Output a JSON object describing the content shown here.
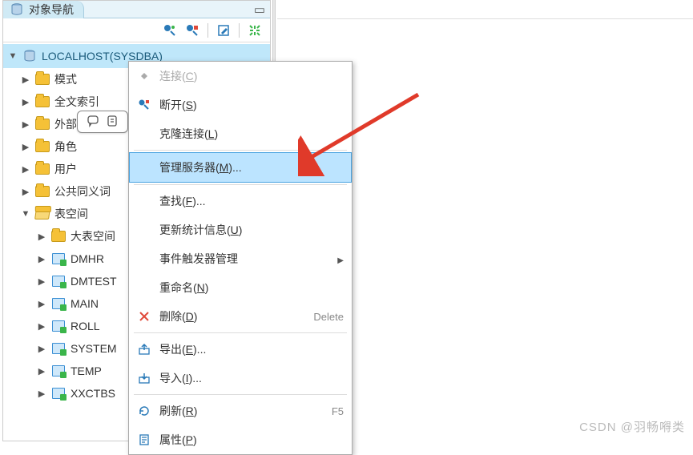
{
  "tab": {
    "title": "对象导航",
    "icon": "db"
  },
  "toolbar": {
    "icons": [
      "new-conn",
      "disconnect",
      "sep",
      "edit",
      "sep",
      "expand-all"
    ]
  },
  "tree": {
    "root": {
      "label": "LOCALHOST(SYSDBA)"
    },
    "level1": [
      {
        "label": "模式",
        "icon": "folder"
      },
      {
        "label": "全文索引",
        "icon": "folder"
      },
      {
        "label": "外部链接",
        "icon": "folder"
      },
      {
        "label": "角色",
        "icon": "folder"
      },
      {
        "label": "用户",
        "icon": "folder"
      },
      {
        "label": "公共同义词",
        "icon": "folder"
      },
      {
        "label": "表空间",
        "icon": "folder-open",
        "expanded": true
      }
    ],
    "tablespaces": [
      {
        "label": "大表空间",
        "icon": "folder"
      },
      {
        "label": "DMHR",
        "icon": "tbsp"
      },
      {
        "label": "DMTEST",
        "icon": "tbsp"
      },
      {
        "label": "MAIN",
        "icon": "tbsp"
      },
      {
        "label": "ROLL",
        "icon": "tbsp"
      },
      {
        "label": "SYSTEM",
        "icon": "tbsp"
      },
      {
        "label": "TEMP",
        "icon": "tbsp"
      },
      {
        "label": "XXCTBS",
        "icon": "tbsp"
      }
    ]
  },
  "context_menu": [
    {
      "label": "连接(",
      "u": "C",
      "tail": ")",
      "icon": "plug",
      "disabled": true
    },
    {
      "label": "断开(",
      "u": "S",
      "tail": ")",
      "icon": "disconnect"
    },
    {
      "label": "克隆连接(",
      "u": "L",
      "tail": ")"
    },
    {
      "sep": true
    },
    {
      "label": "管理服务器(",
      "u": "M",
      "tail": ")...",
      "highlight": true
    },
    {
      "sep": true
    },
    {
      "label": "查找(",
      "u": "F",
      "tail": ")..."
    },
    {
      "label": "更新统计信息(",
      "u": "U",
      "tail": ")"
    },
    {
      "label": "事件触发器管理",
      "submenu": true
    },
    {
      "label": "重命名(",
      "u": "N",
      "tail": ")"
    },
    {
      "label": "删除(",
      "u": "D",
      "tail": ")",
      "icon": "delete",
      "shortcut": "Delete"
    },
    {
      "sep": true
    },
    {
      "label": "导出(",
      "u": "E",
      "tail": ")...",
      "icon": "export"
    },
    {
      "label": "导入(",
      "u": "I",
      "tail": ")...",
      "icon": "import"
    },
    {
      "sep": true
    },
    {
      "label": "刷新(",
      "u": "R",
      "tail": ")",
      "icon": "refresh",
      "shortcut": "F5"
    },
    {
      "label": "属性(",
      "u": "P",
      "tail": ")",
      "icon": "props"
    }
  ],
  "watermark": "CSDN @羽畅嘚类"
}
